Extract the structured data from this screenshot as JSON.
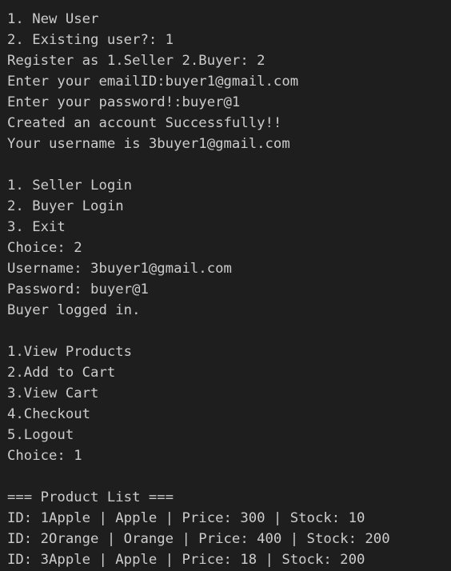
{
  "terminal": {
    "lines": [
      "1. New User",
      "2. Existing user?: 1",
      "Register as 1.Seller 2.Buyer: 2",
      "Enter your emailID:buyer1@gmail.com",
      "Enter your password!:buyer@1",
      "Created an account Successfully!!",
      "Your username is 3buyer1@gmail.com",
      "",
      "1. Seller Login",
      "2. Buyer Login",
      "3. Exit",
      "Choice: 2",
      "Username: 3buyer1@gmail.com",
      "Password: buyer@1",
      "Buyer logged in.",
      "",
      "1.View Products",
      "2.Add to Cart",
      "3.View Cart",
      "4.Checkout",
      "5.Logout",
      "Choice: 1",
      "",
      "=== Product List ===",
      "ID: 1Apple | Apple | Price: 300 | Stock: 10",
      "ID: 2Orange | Orange | Price: 400 | Stock: 200",
      "ID: 3Apple | Apple | Price: 18 | Stock: 200"
    ]
  }
}
